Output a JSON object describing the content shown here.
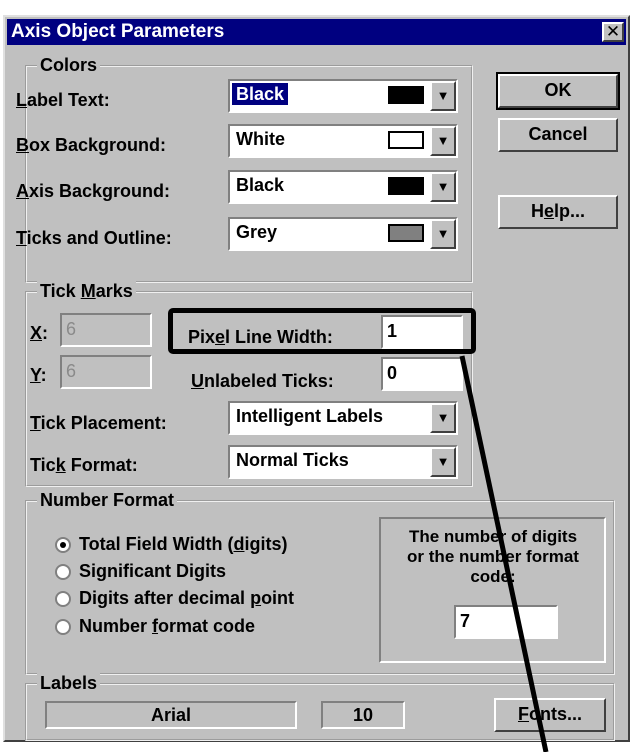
{
  "title": "Axis Object Parameters",
  "close_glyph": "✕",
  "buttons": {
    "ok": "OK",
    "cancel": "Cancel",
    "help_prefix": "H",
    "help_underline": "e",
    "help_suffix": "lp...",
    "fonts_underline": "F",
    "fonts_suffix": "onts..."
  },
  "colors": {
    "group_label": "Colors",
    "rows": [
      {
        "label_u": "L",
        "label_rest": "abel Text:",
        "value": "Black",
        "swatch": "#000000",
        "selected": true
      },
      {
        "label_u": "B",
        "label_rest": "ox Background:",
        "value": "White",
        "swatch": "#ffffff",
        "selected": false
      },
      {
        "label_u": "A",
        "label_rest": "xis Background:",
        "value": "Black",
        "swatch": "#000000",
        "selected": false
      },
      {
        "label_u": "T",
        "label_rest": "icks and Outline:",
        "value": "Grey",
        "swatch": "#808080",
        "selected": false
      }
    ]
  },
  "tick_marks": {
    "group_label_pre": "Tick ",
    "group_label_u": "M",
    "group_label_post": "arks",
    "x_label_u": "X",
    "x_label_post": ":",
    "x_value": "6",
    "y_label_u": "Y",
    "y_label_post": ":",
    "y_value": "6",
    "pixel_label_pre": "Pix",
    "pixel_label_u": "e",
    "pixel_label_post": "l Line Width:",
    "pixel_value": "1",
    "unlabeled_label_u": "U",
    "unlabeled_label_post": "nlabeled Ticks:",
    "unlabeled_value": "0",
    "placement_label_u": "T",
    "placement_label_post": "ick Placement:",
    "placement_value": "Intelligent Labels",
    "format_label_pre": "Tic",
    "format_label_u": "k",
    "format_label_post": " Format:",
    "format_value": "Normal Ticks"
  },
  "number_format": {
    "group_label": "Number Format",
    "options": [
      {
        "pre": "Total Field Width (",
        "u": "d",
        "post": "igits)",
        "checked": true
      },
      {
        "pre": "Significant Di",
        "u": "g",
        "post": "its",
        "checked": false
      },
      {
        "pre": "Digits after decimal ",
        "u": "p",
        "post": "oint",
        "checked": false
      },
      {
        "pre": "Number ",
        "u": "f",
        "post": "ormat code",
        "checked": false
      }
    ],
    "note_line1": "The number of digits",
    "note_line2": "or the number format",
    "note_line3": "code:",
    "digits_value": "7"
  },
  "labels": {
    "group_label": "Labels",
    "font_name": "Arial",
    "font_size": "10"
  }
}
